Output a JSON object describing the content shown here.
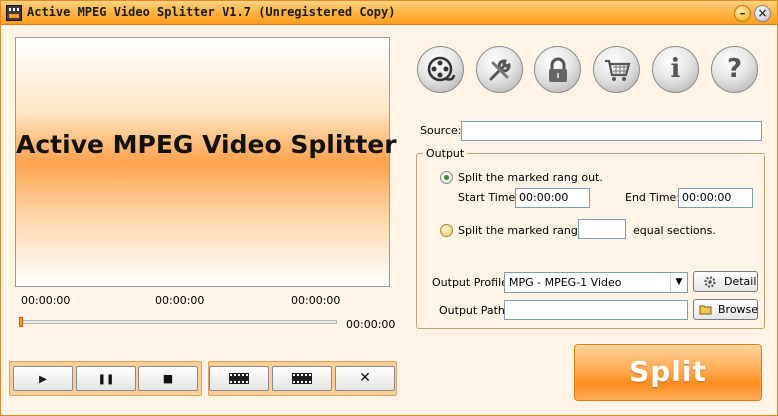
{
  "window": {
    "title": "Active MPEG Video Splitter V1.7 (Unregistered Copy)",
    "minimize_glyph": "–",
    "close_glyph": "×"
  },
  "preview": {
    "title": "Active MPEG Video Splitter"
  },
  "timeline": {
    "start_time": "00:00:00",
    "mid_time": "00:00:00",
    "end_time": "00:00:00",
    "current_time": "00:00:00",
    "position_fraction": 0
  },
  "transport": {
    "play_glyph": "▶",
    "pause_glyph": "❚❚",
    "stop_glyph": "■",
    "close_glyph": "✕"
  },
  "toolbar": {
    "icons": [
      "film-reel-icon",
      "tools-icon",
      "lock-icon",
      "shopping-cart-icon",
      "info-icon",
      "help-icon"
    ],
    "info_glyph": "i",
    "help_glyph": "?"
  },
  "source": {
    "label": "Source:",
    "value": ""
  },
  "output": {
    "legend": "Output",
    "option1_label": "Split the marked rang out.",
    "start_time_label": "Start Time:",
    "start_time_value": "00:00:00",
    "end_time_label": "End Time:",
    "end_time_value": "00:00:00",
    "option2_label": "Split the marked rang to",
    "sections_value": "",
    "sections_suffix": "equal sections.",
    "profile_label": "Output Profile:",
    "profile_value": "MPG - MPEG-1 Video",
    "detail_label": "Detail",
    "path_label": "Output Path:",
    "path_value": "",
    "browse_label": "Browse"
  },
  "split_label": "Split",
  "colors": {
    "accent": "#ff9d22",
    "split_button": "#ffab52",
    "background": "#fff4e6"
  }
}
